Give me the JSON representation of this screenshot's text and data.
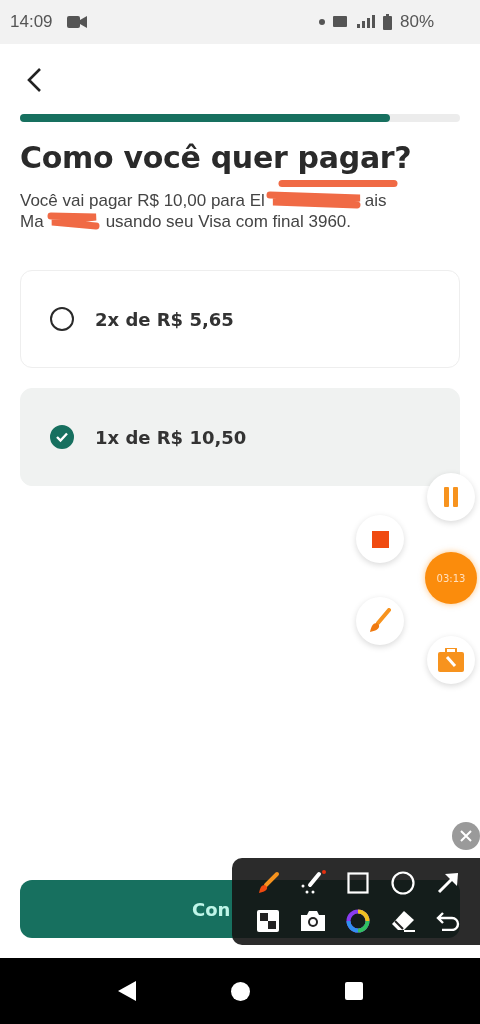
{
  "status_bar": {
    "time": "14:09",
    "battery": "80%"
  },
  "progress": {
    "level": 0.84
  },
  "title": "Como você quer pagar?",
  "description": {
    "line_1": [
      "Você vai pagar R$ 10,00 para El",
      "ais"
    ],
    "line_2": [
      "Ma",
      "usando seu Visa com final 3960."
    ]
  },
  "options": [
    {
      "label": "2x de R$ 5,65",
      "selected": false
    },
    {
      "label": "1x de R$ 10,50",
      "selected": true
    }
  ],
  "continue_button": "Con",
  "recorder": {
    "timer": "03:13"
  }
}
